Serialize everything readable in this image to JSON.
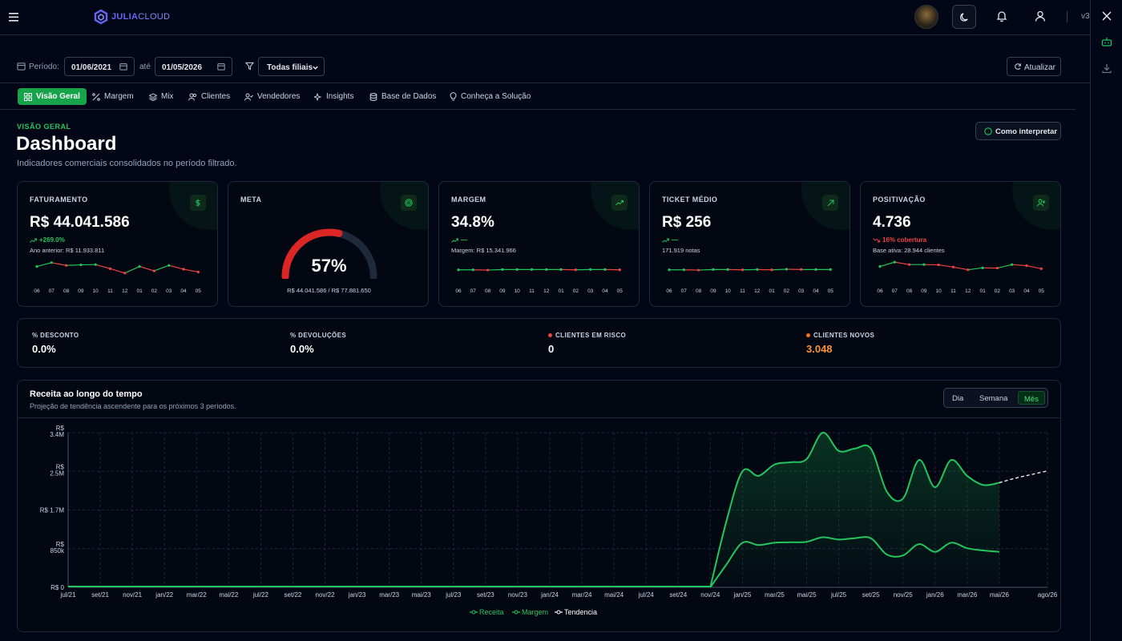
{
  "app": {
    "brand_main": "JULIA",
    "brand_sub": "CLOUD",
    "version": "v3"
  },
  "filters": {
    "period_label": "Período:",
    "date_from": "01/06/2021",
    "until_label": "até",
    "date_to": "01/05/2026",
    "branch_select": "Todas filiais",
    "refresh_label": "Atualizar"
  },
  "tabs": [
    {
      "label": "Visão Geral",
      "icon": "grid-icon"
    },
    {
      "label": "Margem",
      "icon": "percent-icon"
    },
    {
      "label": "Mix",
      "icon": "layers-icon"
    },
    {
      "label": "Clientes",
      "icon": "users-icon"
    },
    {
      "label": "Vendedores",
      "icon": "user-check-icon"
    },
    {
      "label": "Insights",
      "icon": "sparkles-icon"
    },
    {
      "label": "Base de Dados",
      "icon": "database-icon"
    },
    {
      "label": "Conheça a Solução",
      "icon": "lightbulb-icon"
    }
  ],
  "page": {
    "eyebrow": "VISÃO GERAL",
    "title": "Dashboard",
    "subtitle": "Indicadores comerciais consolidados no período filtrado.",
    "interpret_label": "Como interpretar"
  },
  "kpi_months": [
    "06",
    "07",
    "08",
    "09",
    "10",
    "11",
    "12",
    "01",
    "02",
    "03",
    "04",
    "05"
  ],
  "kpis": [
    {
      "label": "FATURAMENTO",
      "icon": "dollar-icon",
      "value": "R$ 44.041.586",
      "delta": "+269.0%",
      "delta_color": "#22c55e",
      "note": "Ano anterior: R$ 11.933.811",
      "spark": [
        4.2,
        5.6,
        4.6,
        4.8,
        4.9,
        3.4,
        1.8,
        4.2,
        2.6,
        4.6,
        3.2,
        2.2
      ]
    },
    {
      "label": "META",
      "icon": "target-icon",
      "gauge_percent": 57,
      "gauge_value": "57%",
      "note": "R$ 44.041.586 / R$ 77.881.650"
    },
    {
      "label": "MARGEM",
      "icon": "trend-up-icon",
      "value": "34.8%",
      "delta": "—",
      "delta_color": "#22c55e",
      "note": "Margem: R$ 15.341.966",
      "spark": [
        3,
        3,
        2.9,
        3.1,
        3.1,
        3.1,
        3.1,
        3.1,
        3.0,
        3.1,
        3.1,
        3.0
      ]
    },
    {
      "label": "TICKET MÉDIO",
      "icon": "arrow-up-right-icon",
      "value": "R$ 256",
      "delta": "—",
      "delta_color": "#22c55e",
      "note": "171.919 notas",
      "spark": [
        3,
        3,
        2.9,
        3.1,
        3.1,
        3.0,
        3.1,
        3.0,
        3.2,
        3.1,
        3.1,
        3.1
      ]
    },
    {
      "label": "POSITIVAÇÃO",
      "icon": "user-plus-icon",
      "value": "4.736",
      "delta": "16% cobertura",
      "delta_color": "#ef4444",
      "note": "Base ativa: 28.944 clientes",
      "spark": [
        4.2,
        5.8,
        4.9,
        4.9,
        4.8,
        4.0,
        3.0,
        3.7,
        3.6,
        4.9,
        4.5,
        3.4
      ]
    }
  ],
  "stats": [
    {
      "label": "% DESCONTO",
      "value": "0.0%",
      "dot": null,
      "value_color": "#ffffff"
    },
    {
      "label": "% DEVOLUÇÕES",
      "value": "0.0%",
      "dot": null,
      "value_color": "#ffffff"
    },
    {
      "label": "CLIENTES EM RISCO",
      "value": "0",
      "dot": "#ef4444",
      "value_color": "#ffffff"
    },
    {
      "label": "CLIENTES NOVOS",
      "value": "3.048",
      "dot": "#f97316",
      "value_color": "#fb923c"
    }
  ],
  "revenue_card": {
    "title": "Receita ao longo do tempo",
    "subtitle": "Projeção de tendência ascendente para os próximos 3 períodos.",
    "granularity": [
      "Dia",
      "Semana",
      "Mês"
    ],
    "granularity_selected": "Mês"
  },
  "chart_data": {
    "type": "area",
    "title": "Receita ao longo do tempo",
    "y_ticks": [
      "R$ 0",
      "R$ 850k",
      "R$ 1.7M",
      "R$ 2.5M",
      "R$ 3.4M"
    ],
    "ylim": [
      0,
      3400000
    ],
    "x_tick_labels": [
      "jul/21",
      "set/21",
      "nov/21",
      "jan/22",
      "mar/22",
      "mai/22",
      "jul/22",
      "set/22",
      "nov/22",
      "jan/23",
      "mar/23",
      "mai/23",
      "jul/23",
      "set/23",
      "nov/23",
      "jan/24",
      "mar/24",
      "mai/24",
      "jul/24",
      "set/24",
      "nov/24",
      "jan/25",
      "mar/25",
      "mai/25",
      "jul/25",
      "set/25",
      "nov/25",
      "jan/26",
      "mar/26",
      "mai/26",
      "ago/26"
    ],
    "series": [
      {
        "name": "Receita",
        "color": "#22c55e",
        "x": [
          "nov/24",
          "dez/24",
          "jan/25",
          "fev/25",
          "mar/25",
          "abr/25",
          "mai/25",
          "jun/25",
          "jul/25",
          "ago/25",
          "set/25",
          "out/25",
          "nov/25",
          "dez/25",
          "jan/26",
          "fev/26",
          "mar/26",
          "abr/26",
          "mai/26"
        ],
        "values": [
          0,
          1450000,
          2550000,
          2450000,
          2700000,
          2750000,
          2820000,
          3400000,
          3000000,
          3050000,
          3050000,
          2100000,
          1950000,
          2800000,
          2200000,
          2800000,
          2450000,
          2250000,
          2300000
        ]
      },
      {
        "name": "Margem",
        "color": "#22c55e",
        "x": [
          "nov/24",
          "dez/24",
          "jan/25",
          "fev/25",
          "mar/25",
          "abr/25",
          "mai/25",
          "jun/25",
          "jul/25",
          "ago/25",
          "set/25",
          "out/25",
          "nov/25",
          "dez/25",
          "jan/26",
          "fev/26",
          "mar/26",
          "abr/26",
          "mai/26"
        ],
        "values": [
          0,
          500000,
          980000,
          930000,
          980000,
          990000,
          1000000,
          1100000,
          1050000,
          1080000,
          1080000,
          720000,
          700000,
          950000,
          780000,
          980000,
          860000,
          810000,
          780000
        ]
      },
      {
        "name": "Tendencia",
        "color": "#ffffff",
        "x": [
          "mai/26",
          "jun/26",
          "jul/26",
          "ago/26"
        ],
        "values": [
          2300000,
          2400000,
          2480000,
          2560000
        ]
      }
    ]
  }
}
